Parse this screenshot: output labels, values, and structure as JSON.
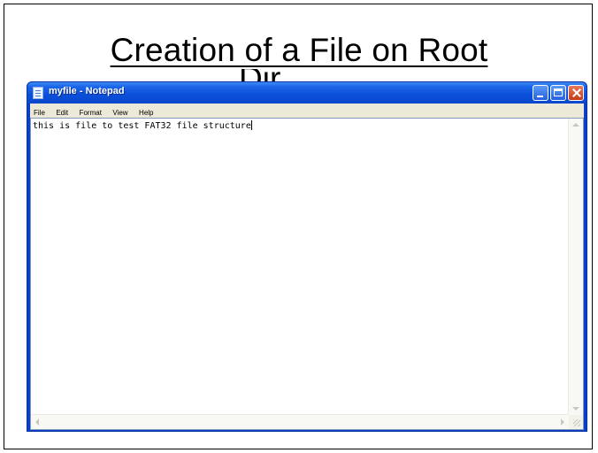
{
  "slide": {
    "title": "Creation of a File on Root",
    "title_overflow": "Dir"
  },
  "notepad": {
    "window_title": "myfile - Notepad",
    "menu": [
      "File",
      "Edit",
      "Format",
      "View",
      "Help"
    ],
    "content": "this is file to test FAT32 file structure",
    "icons": {
      "app": "notepad-icon",
      "minimize": "minimize-icon",
      "maximize": "maximize-icon",
      "close": "close-icon"
    },
    "colors": {
      "titlebar": "#0b4fd9",
      "menubar": "#ece9d8",
      "close_button": "#c63a17"
    }
  }
}
